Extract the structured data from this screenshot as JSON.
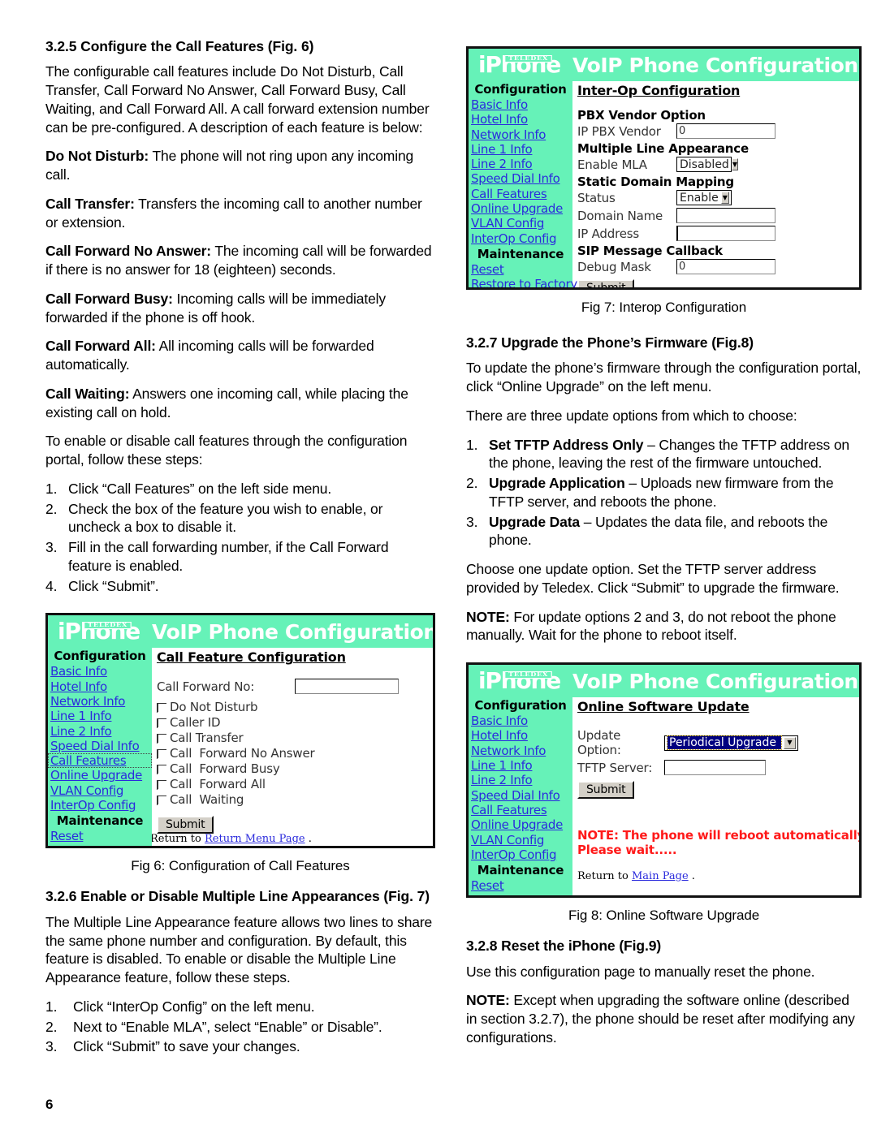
{
  "page": {
    "number": "6"
  },
  "left_column": {
    "section_355": {
      "heading": "3.2.5 Configure the Call Features (Fig. 6)",
      "intro": "The configurable call features include Do Not Disturb, Call Transfer, Call Forward No Answer, Call Forward Busy, Call Waiting, and Call Forward All. A call forward extension number can be pre-configured. A description of each feature is below:",
      "features": [
        {
          "term": "Do Not Disturb:",
          "desc": " The phone will not ring upon any incoming call."
        },
        {
          "term": "Call Transfer:",
          "desc": " Transfers the incoming call to another number or extension."
        },
        {
          "term": "Call Forward No Answer:",
          "desc": " The incoming call will be forwarded if there is no answer for 18 (eighteen) seconds."
        },
        {
          "term": "Call Forward Busy:",
          "desc": " Incoming calls will be immediately forwarded if the phone is off hook."
        },
        {
          "term": "Call Forward All:",
          "desc": " All incoming calls will be forwarded automatically."
        },
        {
          "term": "Call Waiting:",
          "desc": " Answers one incoming call, while placing the existing call on hold."
        }
      ],
      "steps_intro": "To enable or disable call features through the configuration portal, follow these steps:",
      "steps": [
        {
          "num": "1.",
          "text": "Click “Call Features” on the left side menu."
        },
        {
          "num": "2.",
          "text": "Check the box of the feature you wish to enable, or uncheck a box to disable it."
        },
        {
          "num": "3.",
          "text": "Fill in the call forwarding number, if the Call Forward feature is enabled."
        },
        {
          "num": "4.",
          "text": "Click “Submit”."
        }
      ]
    },
    "fig6_caption": "Fig 6: Configuration of Call Features",
    "section_326": {
      "heading": "3.2.6 Enable or Disable Multiple Line Appearances (Fig. 7)",
      "intro": "The Multiple Line Appearance feature allows two lines to share the same phone number and configuration. By default, this feature is disabled. To enable or disable the Multiple Line Appearance feature, follow these steps.",
      "steps": [
        {
          "num": "1.",
          "text": "Click “InterOp Config” on the left menu."
        },
        {
          "num": "2.",
          "text": "Next to “Enable MLA”, select “Enable” or Disable”."
        },
        {
          "num": "3.",
          "text": "Click “Submit” to save your changes."
        }
      ]
    }
  },
  "right_column": {
    "fig7_caption": "Fig 7: Interop Configuration",
    "section_327": {
      "heading": "3.2.7 Upgrade the Phone’s Firmware (Fig.8)",
      "p1": "To update the phone’s firmware through the configuration portal, click “Online Upgrade” on the left menu.",
      "p2": "There are three update options from which to choose:",
      "options": [
        {
          "num": "1.",
          "term": "Set TFTP Address Only",
          "desc": " – Changes the TFTP address on the phone, leaving the rest of the firmware untouched."
        },
        {
          "num": "2.",
          "term": "Upgrade Application",
          "desc": " – Uploads new firmware from the TFTP server, and reboots the phone."
        },
        {
          "num": "3.",
          "term": "Upgrade Data",
          "desc": " – Updates the data file, and reboots the phone."
        }
      ],
      "p3": "Choose one update option. Set the TFTP server address provided by Teledex. Click “Submit” to upgrade the firmware.",
      "note_term": "NOTE:",
      "note_text": " For update options 2 and 3, do not reboot the phone manually. Wait for the phone to reboot itself."
    },
    "fig8_caption": "Fig 8: Online Software Upgrade",
    "section_328": {
      "heading": "3.2.8 Reset the iPhone (Fig.9)",
      "p1": "Use this configuration page to manually reset the phone.",
      "note_term": "NOTE:",
      "note_text": "  Except when upgrading the software online (described in section 3.2.7), the phone should be reset after modifying any configurations."
    }
  },
  "portal": {
    "brand_i": "i",
    "brand_phone": "Phone",
    "brand_tag": "TELEDEX",
    "title": "VoIP Phone Configuration Portal",
    "sidebar_head_config": "Configuration",
    "sidebar_head_maint": "Maintenance",
    "nav": [
      "Basic Info",
      "Hotel Info",
      "Network Info",
      "Line 1 Info",
      "Line 2 Info",
      "Speed Dial Info",
      "Call Features",
      "Online Upgrade",
      "VLAN Config",
      "InterOp Config"
    ],
    "maint": [
      "Reset",
      "Restore to Factory"
    ],
    "colors": {
      "banner_green": "#66f2b8",
      "link_blue": "#2b2bdd",
      "note_red": "#ff1a1a",
      "select_highlight": "#000080"
    },
    "submit_label": "Submit"
  },
  "fig6": {
    "page_heading": "Call Feature Configuration ",
    "call_forward_label": "Call Forward No:",
    "call_forward_value": "",
    "checkboxes": [
      {
        "label": "Do Not Disturb",
        "checked": false
      },
      {
        "label": "Caller ID",
        "checked": false
      },
      {
        "label": "Call Transfer",
        "checked": false
      },
      {
        "label": "Call  Forward No Answer",
        "checked": false
      },
      {
        "label": "Call  Forward Busy",
        "checked": false
      },
      {
        "label": "Call  Forward All",
        "checked": false
      },
      {
        "label": "Call  Waiting",
        "checked": false
      }
    ],
    "return_prefix": "Return to ",
    "return_link": "Return Menu Page",
    "return_suffix": " ."
  },
  "fig7": {
    "page_heading": "Inter-Op Configuration",
    "groups": [
      {
        "title": "PBX Vendor Option",
        "rows": [
          {
            "label": "IP PBX Vendor",
            "type": "text",
            "value": "0"
          }
        ]
      },
      {
        "title": "Multiple Line Appearance",
        "rows": [
          {
            "label": "Enable MLA",
            "type": "select",
            "value": "Disabled"
          }
        ]
      },
      {
        "title": "Static Domain Mapping",
        "rows": [
          {
            "label": "Status",
            "type": "select",
            "value": "Enable"
          },
          {
            "label": "Domain Name",
            "type": "text",
            "value": ""
          },
          {
            "label": "IP Address",
            "type": "text",
            "value": ""
          }
        ]
      },
      {
        "title": "SIP Message Callback",
        "rows": [
          {
            "label": "Debug Mask",
            "type": "text",
            "value": "0"
          }
        ]
      }
    ]
  },
  "fig8": {
    "page_heading": "Online Software Update",
    "update_option_label": "Update Option:",
    "update_option_value": "Periodical Upgrade",
    "tftp_label": "TFTP Server:",
    "tftp_value": "",
    "note_line1": "NOTE: The phone will reboot automatically after upload.",
    "note_line2": "Please wait.....",
    "return_prefix": "Return to ",
    "return_link": "Main Page",
    "return_suffix": " ."
  }
}
